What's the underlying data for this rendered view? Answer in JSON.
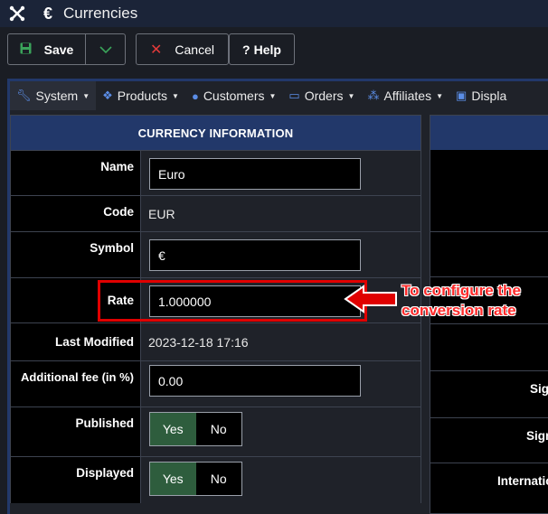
{
  "header": {
    "title": "Currencies",
    "currency_symbol_icon": "€"
  },
  "toolbar": {
    "save": "Save",
    "cancel": "Cancel",
    "help": "Help",
    "help_prefix": "?"
  },
  "nav": {
    "items": [
      {
        "label": "System",
        "icon": "wrench-icon"
      },
      {
        "label": "Products",
        "icon": "cubes-icon"
      },
      {
        "label": "Customers",
        "icon": "user-icon"
      },
      {
        "label": "Orders",
        "icon": "credit-card-icon"
      },
      {
        "label": "Affiliates",
        "icon": "users-icon"
      },
      {
        "label": "Displa",
        "icon": "monitor-icon"
      }
    ]
  },
  "form": {
    "heading": "CURRENCY INFORMATION",
    "name_label": "Name",
    "name_value": "Euro",
    "code_label": "Code",
    "code_value": "EUR",
    "symbol_label": "Symbol",
    "symbol_value": "€",
    "rate_label": "Rate",
    "rate_value": "1.000000",
    "modified_label": "Last Modified",
    "modified_value": "2023-12-18 17:16",
    "fee_label": "Additional fee (in %)",
    "fee_value": "0.00",
    "published_label": "Published",
    "displayed_label": "Displayed",
    "yes": "Yes",
    "no": "No"
  },
  "side_panel": {
    "labels": [
      "Sig",
      "Sign",
      "Internatio"
    ]
  },
  "annotation": {
    "line1": "To configure the",
    "line2": "conversion rate",
    "color": "#ff2a2a"
  },
  "colors": {
    "accent": "#22386a",
    "toggle_on": "#2e5d3d",
    "highlight": "#e00000"
  }
}
